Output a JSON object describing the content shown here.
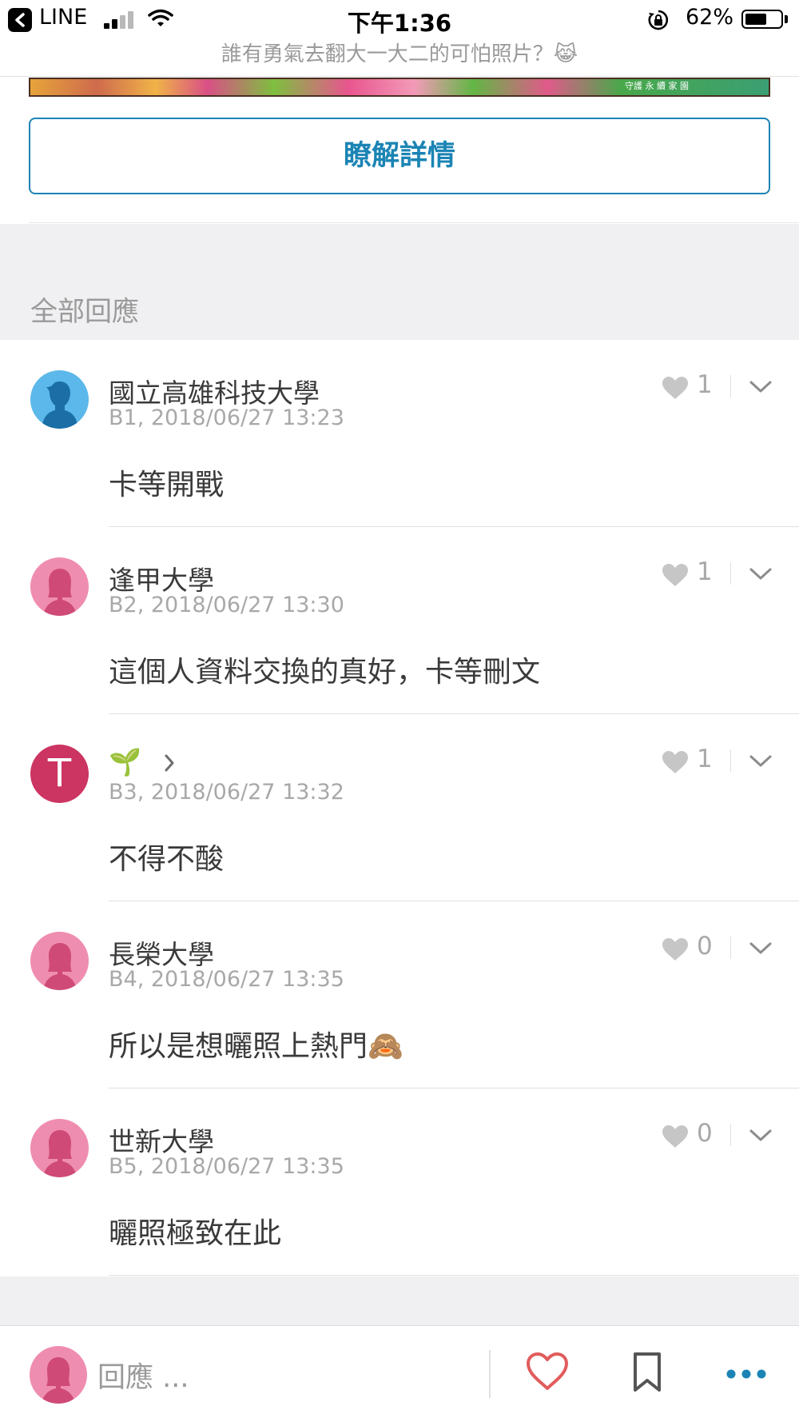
{
  "status_bar": {
    "back_app": "LINE",
    "time": "下午1:36",
    "battery_percent": "62%",
    "battery_level": 0.62
  },
  "nav": {
    "title": "誰有勇氣去翻大一大二的可怕照片？😹"
  },
  "ad": {
    "strip_text": "守護 永 續 家 園",
    "cta_label": "瞭解詳情"
  },
  "comments_section": {
    "title": "全部回應",
    "items": [
      {
        "author": "國立高雄科技大學",
        "meta": "B1, 2018/06/27 13:23",
        "body": "卡等開戰",
        "likes": "1",
        "avatar": "male-silhouette",
        "avatar_color": "#5cb8ea"
      },
      {
        "author": "逢甲大學",
        "meta": "B2, 2018/06/27 13:30",
        "body": "這個人資料交換的真好，卡等刪文",
        "likes": "1",
        "avatar": "female-silhouette",
        "avatar_color": "#ef8db0"
      },
      {
        "author": "🌱",
        "meta": "B3, 2018/06/27 13:32",
        "body": "不得不酸",
        "likes": "1",
        "avatar": "letter",
        "avatar_letter": "T",
        "avatar_color": "#cc3461"
      },
      {
        "author": "長榮大學",
        "meta": "B4, 2018/06/27 13:35",
        "body": "所以是想曬照上熱門🙈",
        "likes": "0",
        "avatar": "female-silhouette",
        "avatar_color": "#ef8db0"
      },
      {
        "author": "世新大學",
        "meta": "B5, 2018/06/27 13:35",
        "body": "曬照極致在此",
        "likes": "0",
        "avatar": "female-silhouette",
        "avatar_color": "#ef8db0"
      }
    ]
  },
  "bottom_bar": {
    "reply_placeholder": "回應 ..."
  },
  "colors": {
    "accent": "#1b84b4",
    "like_heart": "#e25c5c",
    "secondary_text": "#a8a8a8"
  }
}
